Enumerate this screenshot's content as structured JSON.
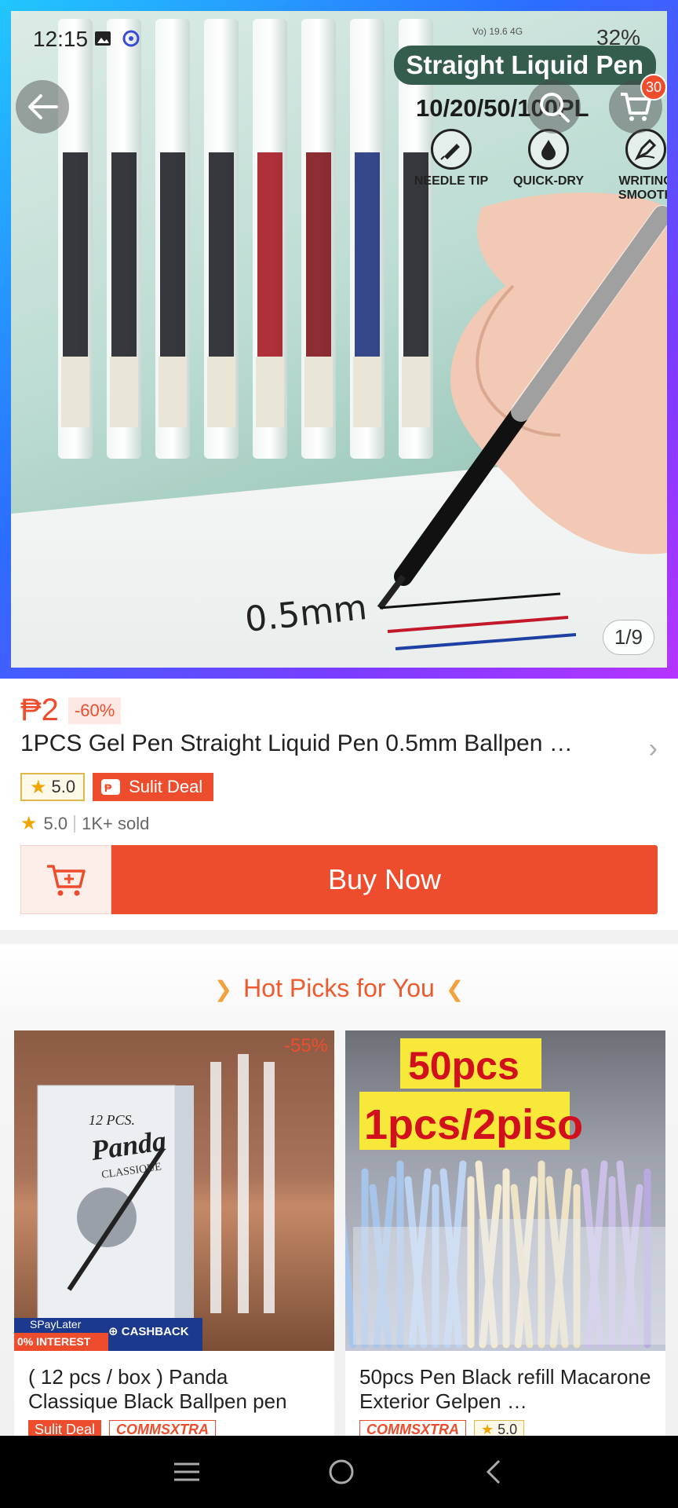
{
  "status_bar": {
    "time": "12:15",
    "signal_text": "Vo) 19.6 4G",
    "battery": "32%"
  },
  "hero": {
    "overlay_title": "Straight Liquid Pen",
    "overlay_sub": "10/20/50/100PL",
    "features": [
      {
        "label": "NEEDLE TIP",
        "icon": "needle-tip-icon"
      },
      {
        "label": "QUICK-DRY",
        "icon": "ink-drop-icon"
      },
      {
        "label": "WRITING SMOOTH",
        "icon": "pen-nib-icon"
      }
    ],
    "tip_size_caption": "0.5mm",
    "image_counter": "1/9"
  },
  "cart": {
    "badge": "30"
  },
  "product": {
    "price": "₱2",
    "discount": "-60%",
    "title": "1PCS Gel Pen Straight Liquid Pen 0.5mm Ballpen …",
    "rating_tag": "5.0",
    "deal_tag": "Sulit Deal",
    "rating": "5.0",
    "sold": "1K+ sold",
    "buy_label": "Buy Now"
  },
  "hot_picks": {
    "title": "Hot Picks for You",
    "items": [
      {
        "name": "( 12 pcs / box ) Panda Classique Black Ballpen pen",
        "discount": "-55%",
        "image_text_box": "Panda",
        "image_text_box_small": "12 PCS.",
        "image_text_box_sub": "CLASSIQUE",
        "paylater": "SPayLater",
        "interest": "0% INTEREST",
        "cashback": "CASHBACK",
        "tags": [
          "Sulit Deal",
          "COMMSXTRA"
        ]
      },
      {
        "name": "50pcs Pen Black refill Macarone Exterior Gelpen …",
        "image_text_1": "50pcs",
        "image_text_2": "1pcs/2piso",
        "tags": [
          "COMMSXTRA",
          "5.0"
        ]
      }
    ]
  },
  "colors": {
    "accent": "#ee4d2d",
    "hot_picks_title": "#ee5a2d"
  }
}
